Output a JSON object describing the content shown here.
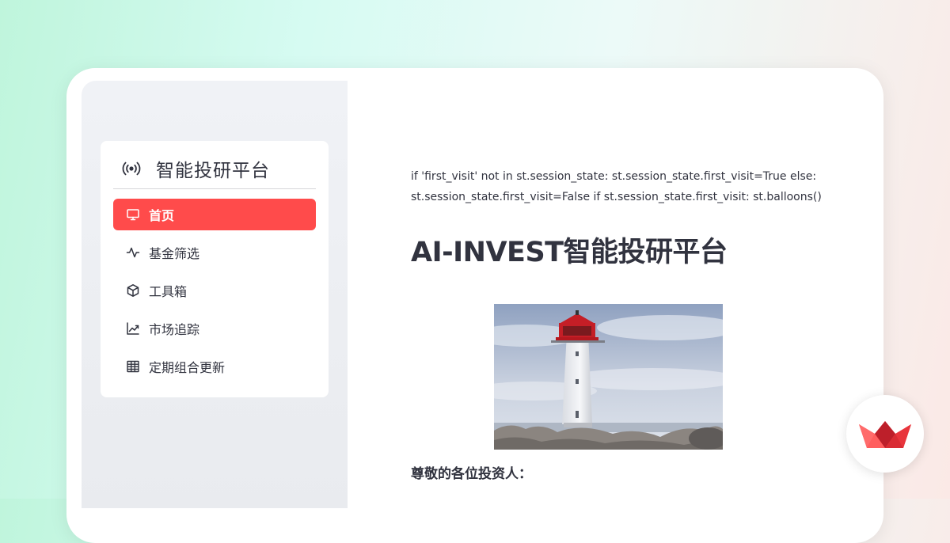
{
  "sidebar": {
    "app_title": "智能投研平台",
    "items": [
      {
        "label": "首页",
        "icon": "monitor-icon",
        "active": true
      },
      {
        "label": "基金筛选",
        "icon": "activity-icon",
        "active": false
      },
      {
        "label": "工具箱",
        "icon": "box-icon",
        "active": false
      },
      {
        "label": "市场追踪",
        "icon": "trend-up-icon",
        "active": false
      },
      {
        "label": "定期组合更新",
        "icon": "table-icon",
        "active": false
      }
    ]
  },
  "main": {
    "code_line": "if 'first_visit' not in st.session_state: st.session_state.first_visit=True else: st.session_state.first_visit=False if st.session_state.first_visit: st.balloons()",
    "title": "AI-INVEST智能投研平台",
    "greeting": "尊敬的各位投资人："
  },
  "colors": {
    "accent": "#ff4b4b",
    "text": "#31333f",
    "sidebar_bg": "#f0f2f6"
  }
}
